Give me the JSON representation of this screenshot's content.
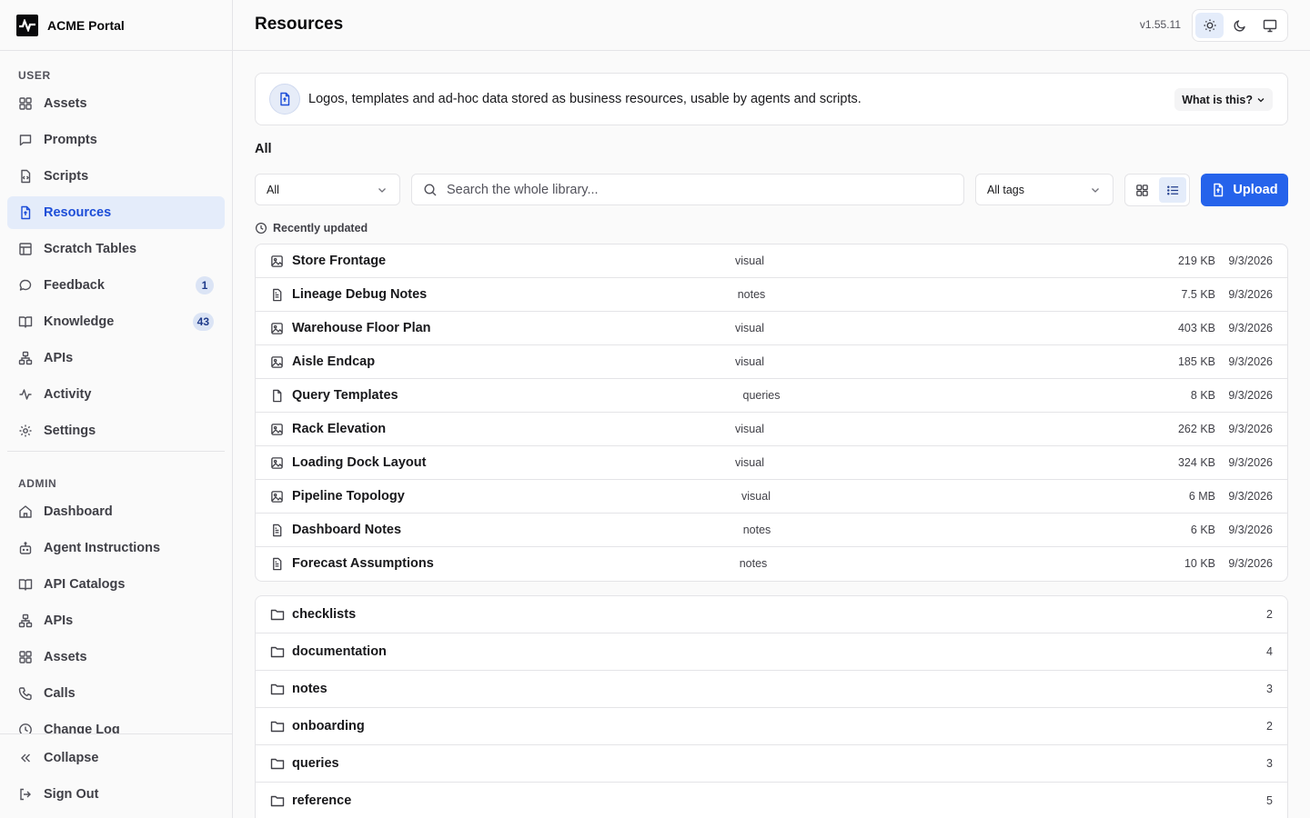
{
  "app": {
    "name": "ACME Portal"
  },
  "header": {
    "title": "Resources",
    "version": "v1.55.11"
  },
  "sidebar": {
    "user_title": "USER",
    "user_items": [
      {
        "label": "Assets",
        "icon": "grid-icon"
      },
      {
        "label": "Prompts",
        "icon": "message-square-icon"
      },
      {
        "label": "Scripts",
        "icon": "file-code-icon"
      },
      {
        "label": "Resources",
        "icon": "file-icon",
        "active": true
      },
      {
        "label": "Scratch Tables",
        "icon": "table-icon"
      },
      {
        "label": "Feedback",
        "icon": "message-circle-icon",
        "badge": "1"
      },
      {
        "label": "Knowledge",
        "icon": "book-open-icon",
        "badge": "43"
      },
      {
        "label": "APIs",
        "icon": "network-icon"
      },
      {
        "label": "Activity",
        "icon": "activity-icon"
      },
      {
        "label": "Settings",
        "icon": "gear-icon"
      }
    ],
    "admin_title": "ADMIN",
    "admin_items": [
      {
        "label": "Dashboard",
        "icon": "home-icon"
      },
      {
        "label": "Agent Instructions",
        "icon": "bot-icon"
      },
      {
        "label": "API Catalogs",
        "icon": "book-open-icon"
      },
      {
        "label": "APIs",
        "icon": "network-icon"
      },
      {
        "label": "Assets",
        "icon": "grid-icon"
      },
      {
        "label": "Calls",
        "icon": "phone-icon"
      },
      {
        "label": "Change Log",
        "icon": "clock-icon"
      }
    ],
    "collapse_label": "Collapse",
    "signout_label": "Sign Out"
  },
  "banner": {
    "text": "Logos, templates and ad-hoc data stored as business resources, usable by agents and scripts.",
    "what_label": "What is this?"
  },
  "breadcrumb": "All",
  "filters": {
    "type_value": "All",
    "search_placeholder": "Search the whole library...",
    "tags_value": "All tags",
    "upload_label": "Upload"
  },
  "recent": {
    "label": "Recently updated",
    "items": [
      {
        "name": "Store Frontage",
        "tag": "visual",
        "size": "219 KB",
        "date": "9/3/2026",
        "icon": "image-icon"
      },
      {
        "name": "Lineage Debug Notes",
        "tag": "notes",
        "size": "7.5 KB",
        "date": "9/3/2026",
        "icon": "file-text-icon"
      },
      {
        "name": "Warehouse Floor Plan",
        "tag": "visual",
        "size": "403 KB",
        "date": "9/3/2026",
        "icon": "image-icon"
      },
      {
        "name": "Aisle Endcap",
        "tag": "visual",
        "size": "185 KB",
        "date": "9/3/2026",
        "icon": "image-icon"
      },
      {
        "name": "Query Templates",
        "tag": "queries",
        "size": "8 KB",
        "date": "9/3/2026",
        "icon": "file-icon"
      },
      {
        "name": "Rack Elevation",
        "tag": "visual",
        "size": "262 KB",
        "date": "9/3/2026",
        "icon": "image-icon"
      },
      {
        "name": "Loading Dock Layout",
        "tag": "visual",
        "size": "324 KB",
        "date": "9/3/2026",
        "icon": "image-icon"
      },
      {
        "name": "Pipeline Topology",
        "tag": "visual",
        "size": "6 MB",
        "date": "9/3/2026",
        "icon": "image-icon"
      },
      {
        "name": "Dashboard Notes",
        "tag": "notes",
        "size": "6 KB",
        "date": "9/3/2026",
        "icon": "file-text-icon"
      },
      {
        "name": "Forecast Assumptions",
        "tag": "notes",
        "size": "10 KB",
        "date": "9/3/2026",
        "icon": "file-text-icon"
      }
    ]
  },
  "folders": [
    {
      "name": "checklists",
      "count": "2"
    },
    {
      "name": "documentation",
      "count": "4"
    },
    {
      "name": "notes",
      "count": "3"
    },
    {
      "name": "onboarding",
      "count": "2"
    },
    {
      "name": "queries",
      "count": "3"
    },
    {
      "name": "reference",
      "count": "5"
    }
  ],
  "colors": {
    "accent": "#2563eb",
    "active_bg": "#e4ecfa",
    "border": "#e4e4e7",
    "background": "#fafafa"
  }
}
